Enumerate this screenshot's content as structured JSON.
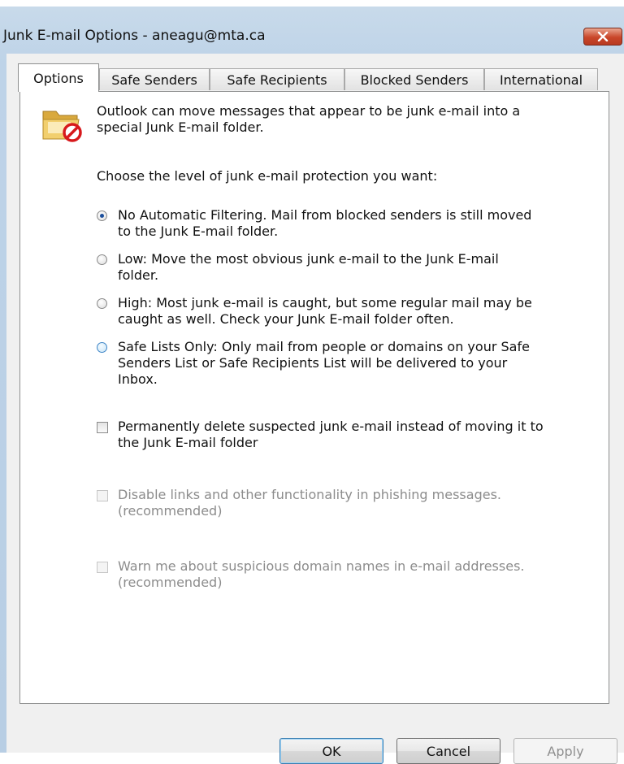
{
  "window": {
    "title": "Junk E-mail Options - aneagu@mta.ca"
  },
  "tabs": [
    {
      "label": "Options",
      "active": true
    },
    {
      "label": "Safe Senders"
    },
    {
      "label": "Safe Recipients"
    },
    {
      "label": "Blocked Senders"
    },
    {
      "label": "International"
    }
  ],
  "intro": {
    "line1": "Outlook can move messages that appear to be junk e-mail into a",
    "line2": "special Junk E-mail folder."
  },
  "level_prompt": "Choose the level of junk e-mail protection you want:",
  "protection_levels": [
    {
      "line1": "No Automatic Filtering. Mail from blocked senders is still moved",
      "line2": "to the Junk E-mail folder.",
      "selected": true
    },
    {
      "line1": "Low: Move the most obvious junk e-mail to the Junk E-mail",
      "line2": "folder.",
      "selected": false
    },
    {
      "line1": "High: Most junk e-mail is caught, but some regular mail may be",
      "line2": "caught as well. Check your Junk E-mail folder often.",
      "selected": false
    },
    {
      "line1": "Safe Lists Only: Only mail from people or domains on your Safe",
      "line2": "Senders List or Safe Recipients List will be delivered to your",
      "line3": "Inbox.",
      "selected": false
    }
  ],
  "checkboxes": [
    {
      "line1": "Permanently delete suspected junk e-mail instead of moving it to",
      "line2": "the Junk E-mail folder",
      "checked": false,
      "enabled": true
    },
    {
      "line1": "Disable links and other functionality in phishing messages.",
      "line2": "(recommended)",
      "checked": false,
      "enabled": false
    },
    {
      "line1": "Warn me about suspicious domain names in e-mail addresses.",
      "line2": "(recommended)",
      "checked": false,
      "enabled": false
    }
  ],
  "buttons": {
    "ok": "OK",
    "cancel": "Cancel",
    "apply": "Apply"
  },
  "icons": {
    "close": "close-icon",
    "junk_folder": "junk-folder-icon"
  },
  "colors": {
    "titlebar": "#c8daea",
    "close_button": "#c9462a",
    "dialog_background": "#f0f0f0",
    "panel_background": "#ffffff",
    "disabled_text": "#8c8c8c"
  }
}
